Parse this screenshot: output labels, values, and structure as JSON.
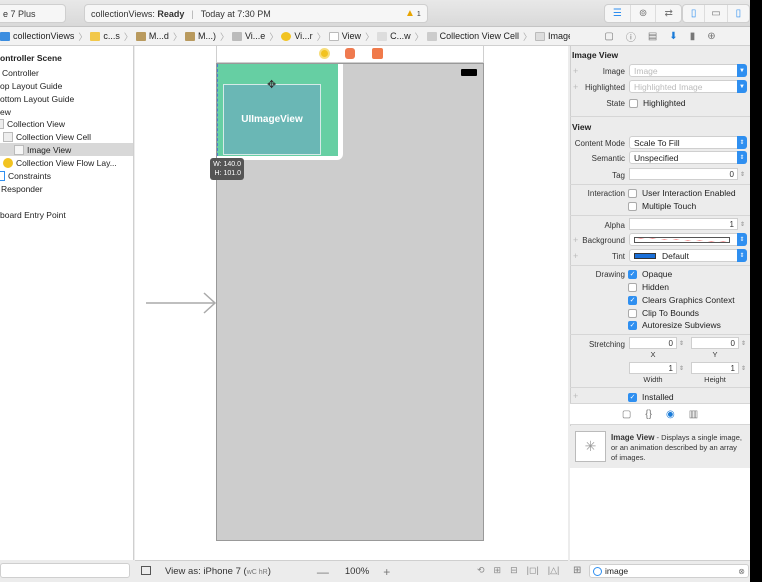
{
  "toolbar": {
    "scheme_label": "e 7 Plus",
    "status_project": "collectionViews:",
    "status_state": "Ready",
    "status_time": "Today at 7:30 PM",
    "warning_count": "1",
    "editor_modes": [
      "standard-editor-icon",
      "assistant-editor-icon",
      "version-editor-icon"
    ],
    "panel_toggles": [
      "navigator-toggle-icon",
      "debug-toggle-icon",
      "utilities-toggle-icon"
    ]
  },
  "jumpbar": {
    "crumbs": [
      {
        "label": "collectionViews",
        "icon": "project-icon"
      },
      {
        "label": "c...s",
        "icon": "folder-icon"
      },
      {
        "label": "M...d",
        "icon": "storyboard-file-icon"
      },
      {
        "label": "M...)",
        "icon": "storyboard-file-icon"
      },
      {
        "label": "Vi...e",
        "icon": "scene-icon"
      },
      {
        "label": "Vi...r",
        "icon": "view-controller-icon"
      },
      {
        "label": "View",
        "icon": "view-icon"
      },
      {
        "label": "C...w",
        "icon": "collection-view-icon"
      },
      {
        "label": "Collection View Cell",
        "icon": "cell-icon"
      },
      {
        "label": "Image View",
        "icon": "image-view-icon"
      }
    ]
  },
  "outline": {
    "items": [
      {
        "label": "ontroller Scene",
        "bold": true
      },
      {
        "label": "Controller"
      },
      {
        "label": "op Layout Guide"
      },
      {
        "label": "ottom Layout Guide"
      },
      {
        "label": "ew"
      },
      {
        "label": "Collection View"
      },
      {
        "label": "Collection View Cell"
      },
      {
        "label": "Image View",
        "selected": true
      },
      {
        "label": "Collection View Flow Lay..."
      },
      {
        "label": "Constraints"
      },
      {
        "label": "Responder"
      },
      {
        "label": "board Entry Point"
      }
    ]
  },
  "canvas": {
    "image_view_label": "UIImageView",
    "size_w": "W: 140.0",
    "size_h": "H: 101.0"
  },
  "bottombar": {
    "view_as": "View as: iPhone 7 (",
    "size_class": "wC hR",
    "view_as_end": ")",
    "zoom_minus": "—",
    "zoom": "100%",
    "zoom_plus": "+"
  },
  "inspector": {
    "image_view_title": "Image View",
    "image_label": "Image",
    "image_placeholder": "Image",
    "highlighted_label": "Highlighted",
    "highlighted_placeholder": "Highlighted Image",
    "state_label": "State",
    "state_checkbox": {
      "label": "Highlighted",
      "checked": false
    },
    "view_title": "View",
    "content_mode_label": "Content Mode",
    "content_mode": "Scale To Fill",
    "semantic_label": "Semantic",
    "semantic": "Unspecified",
    "tag_label": "Tag",
    "tag": "0",
    "interaction_label": "Interaction",
    "user_interaction": {
      "label": "User Interaction Enabled",
      "checked": false
    },
    "multiple_touch": {
      "label": "Multiple Touch",
      "checked": false
    },
    "alpha_label": "Alpha",
    "alpha": "1",
    "background_label": "Background",
    "tint_label": "Tint",
    "tint": "Default",
    "tint_color": "#1a6fd8",
    "drawing_label": "Drawing",
    "opaque": {
      "label": "Opaque",
      "checked": true
    },
    "hidden": {
      "label": "Hidden",
      "checked": false
    },
    "clears": {
      "label": "Clears Graphics Context",
      "checked": true
    },
    "clip": {
      "label": "Clip To Bounds",
      "checked": false
    },
    "autoresize": {
      "label": "Autoresize Subviews",
      "checked": true
    },
    "stretching_label": "Stretching",
    "stretch_x": "0",
    "stretch_y": "0",
    "stretch_w": "1",
    "stretch_h": "1",
    "x_label": "X",
    "y_label": "Y",
    "width_label": "Width",
    "height_label": "Height",
    "installed": {
      "label": "Installed",
      "checked": true
    }
  },
  "library": {
    "item_title": "Image View",
    "item_desc": " - Displays a single image, or an animation described by an array of images.",
    "filter_value": "image"
  },
  "colors": {
    "accent": "#2f8ff0",
    "cell_green": "#66cfa3",
    "image_view": "#6ab7b5",
    "warning": "#e8a400"
  }
}
